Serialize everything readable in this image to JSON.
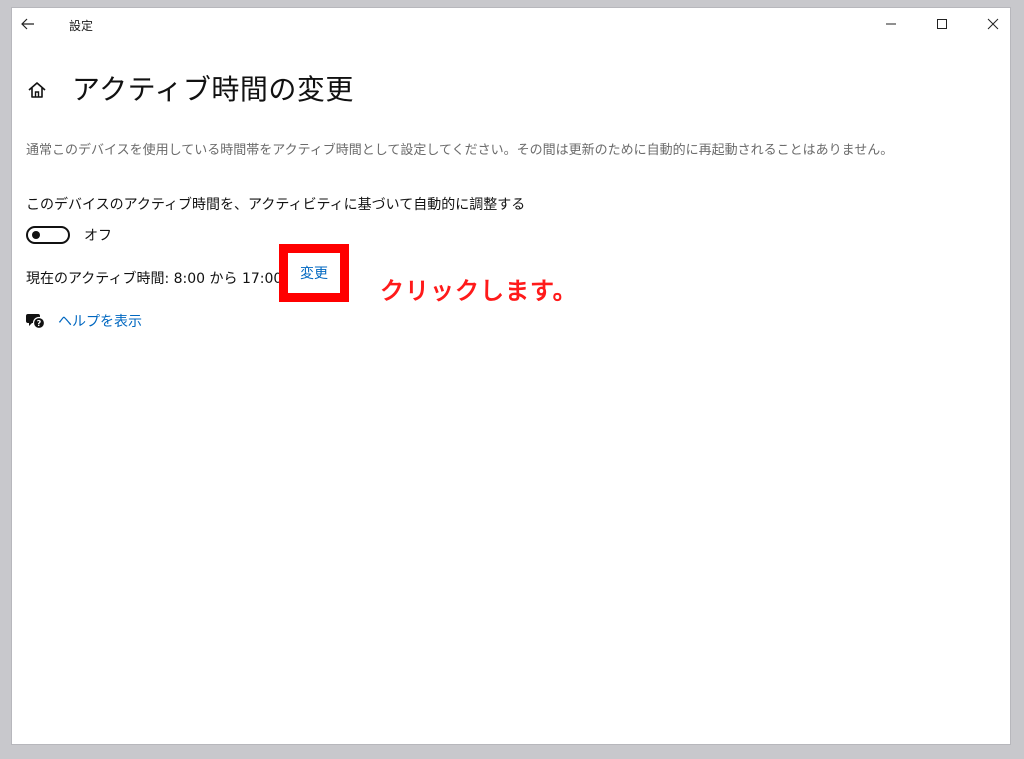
{
  "window": {
    "title": "設定"
  },
  "page": {
    "title": "アクティブ時間の変更",
    "description": "通常このデバイスを使用している時間帯をアクティブ時間として設定してください。その間は更新のために自動的に再起動されることはありません。"
  },
  "auto_adjust": {
    "label": "このデバイスのアクティブ時間を、アクティビティに基づいて自動的に調整する",
    "toggle_state": "オフ",
    "is_on": false
  },
  "active_hours": {
    "text": "現在のアクティブ時間: 8:00 から 17:00 まで",
    "change_link": "変更"
  },
  "help": {
    "link": "ヘルプを表示"
  },
  "annotation": {
    "text": "クリックします。",
    "color": "#ff0000"
  },
  "icons": {
    "back": "back-arrow-icon",
    "home": "home-icon",
    "help": "help-chat-icon",
    "minimize": "minimize-icon",
    "maximize": "maximize-icon",
    "close": "close-icon"
  },
  "colors": {
    "link": "#0067c0",
    "highlight": "#ff0000",
    "description": "#6b6b6b"
  }
}
